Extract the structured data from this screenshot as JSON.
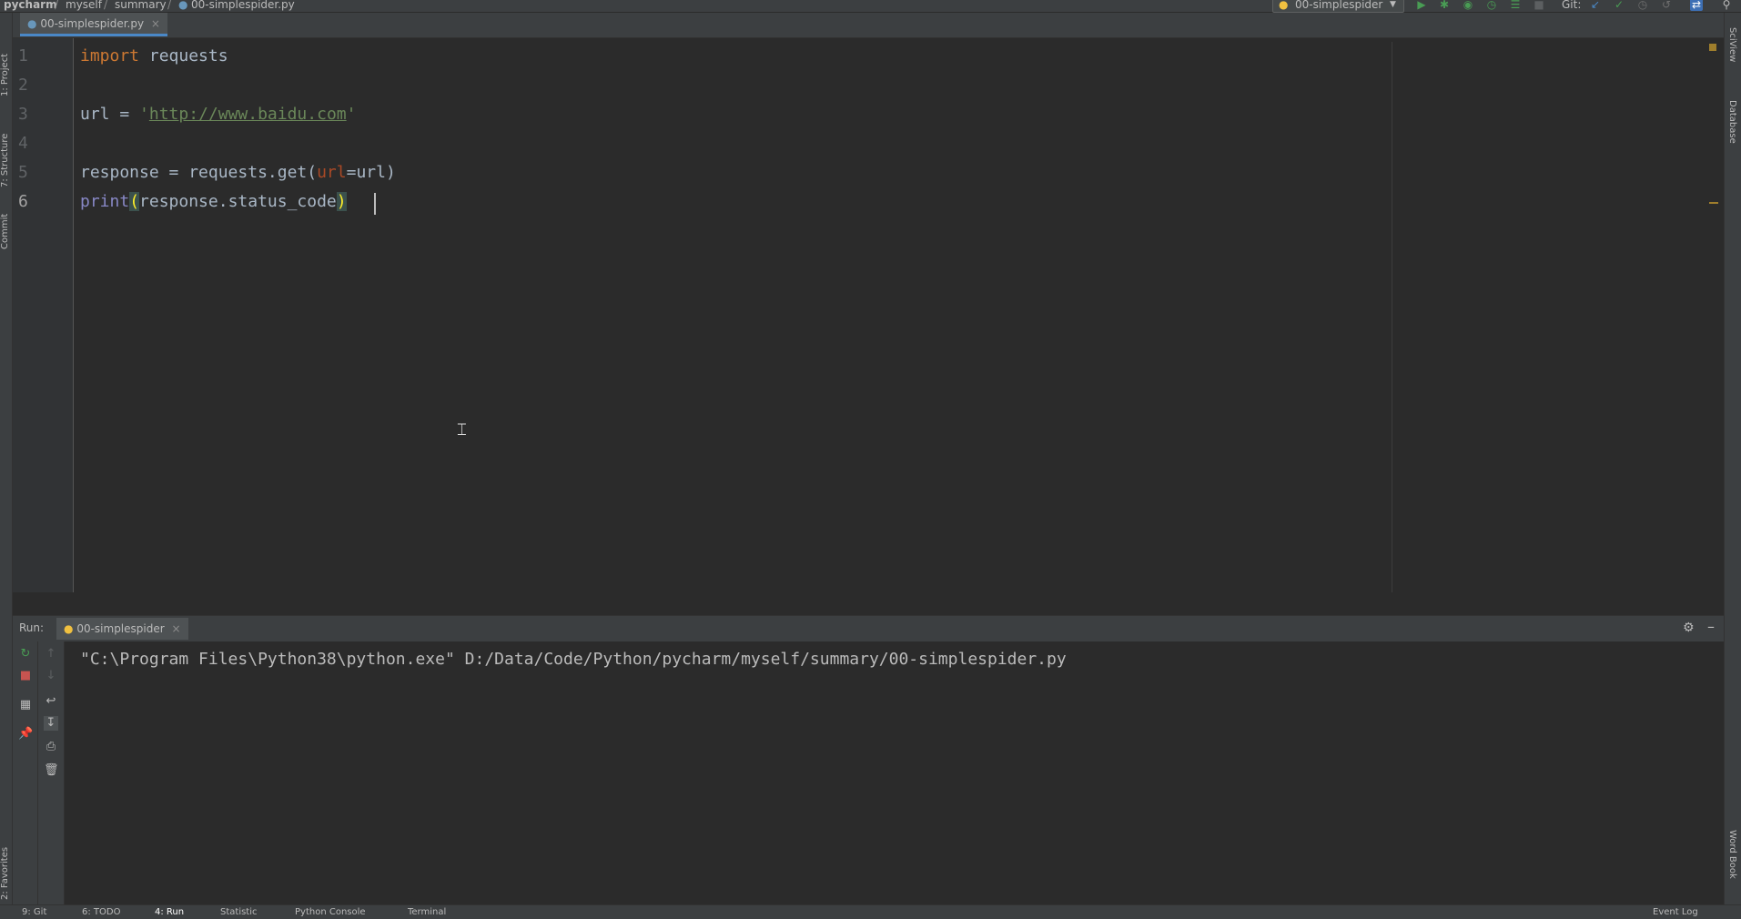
{
  "breadcrumb": [
    "pycharm",
    "myself",
    "summary",
    "00-simplespider.py"
  ],
  "toolbar": {
    "run_config": "00-simplespider",
    "git_label": "Git:",
    "icons": [
      "run-icon",
      "debug-icon",
      "coverage-icon",
      "profile-icon",
      "concurrency-icon",
      "stop-icon",
      "git-update-icon",
      "git-commit-icon",
      "git-history-icon",
      "git-rollback-icon",
      "translate-icon",
      "search-icon"
    ]
  },
  "left_strip": {
    "project": "1: Project",
    "structure": "7: Structure",
    "commit": "Commit",
    "favorites": "2: Favorites"
  },
  "right_strip": {
    "sciview": "SciView",
    "database": "Database",
    "wordbook": "Word Book"
  },
  "editor": {
    "tab": "00-simplespider.py",
    "line_numbers": [
      "1",
      "2",
      "3",
      "4",
      "5",
      "6"
    ],
    "code": {
      "l1_kw": "import",
      "l1_rest": " requests",
      "l3_a": "url = ",
      "l3_q1": "'",
      "l3_url": "http://www.baidu.com",
      "l3_q2": "'",
      "l5_a": "response = requests.get(",
      "l5_param": "url",
      "l5_b": "=url)",
      "l6_fn": "print",
      "l6_open": "(",
      "l6_mid": "response.status_code",
      "l6_close": ")"
    }
  },
  "run": {
    "label": "Run:",
    "tab": "00-simplespider",
    "output": "\"C:\\Program Files\\Python38\\python.exe\" D:/Data/Code/Python/pycharm/myself/summary/00-simplespider.py"
  },
  "bottom": {
    "git": "9: Git",
    "todo": "6: TODO",
    "run": "4: Run",
    "statistic": "Statistic",
    "console": "Python Console",
    "terminal": "Terminal",
    "eventlog": "Event Log"
  },
  "colors": {
    "accent": "#4a88c7",
    "keyword": "#cc7832",
    "string": "#6a8759",
    "run_green": "#499c54",
    "stop_red": "#c75450"
  }
}
